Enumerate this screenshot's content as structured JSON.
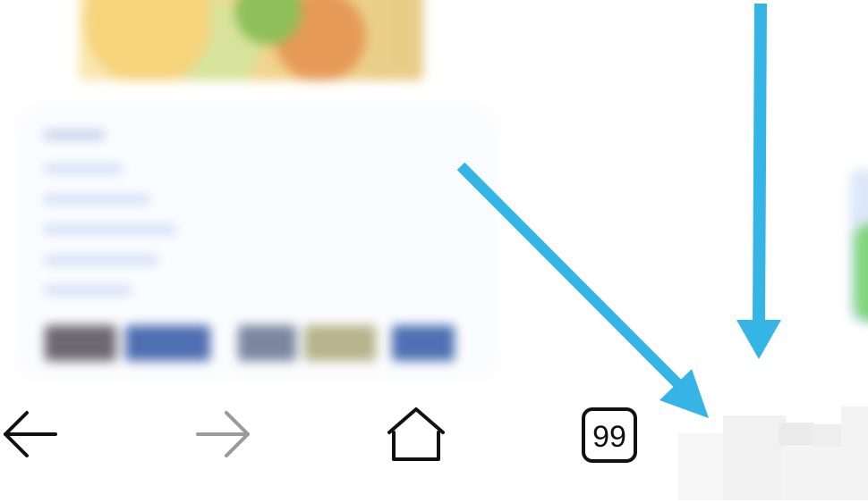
{
  "nav": {
    "back_icon": "back-arrow-icon",
    "forward_icon": "forward-arrow-icon",
    "home_icon": "home-icon",
    "tabs_icon": "tabs-icon",
    "tab_count": "99"
  },
  "colors": {
    "arrow": "#35b5e5",
    "icon": "#111111",
    "icon_disabled": "#9a9a9a",
    "background": "#ffffff"
  }
}
